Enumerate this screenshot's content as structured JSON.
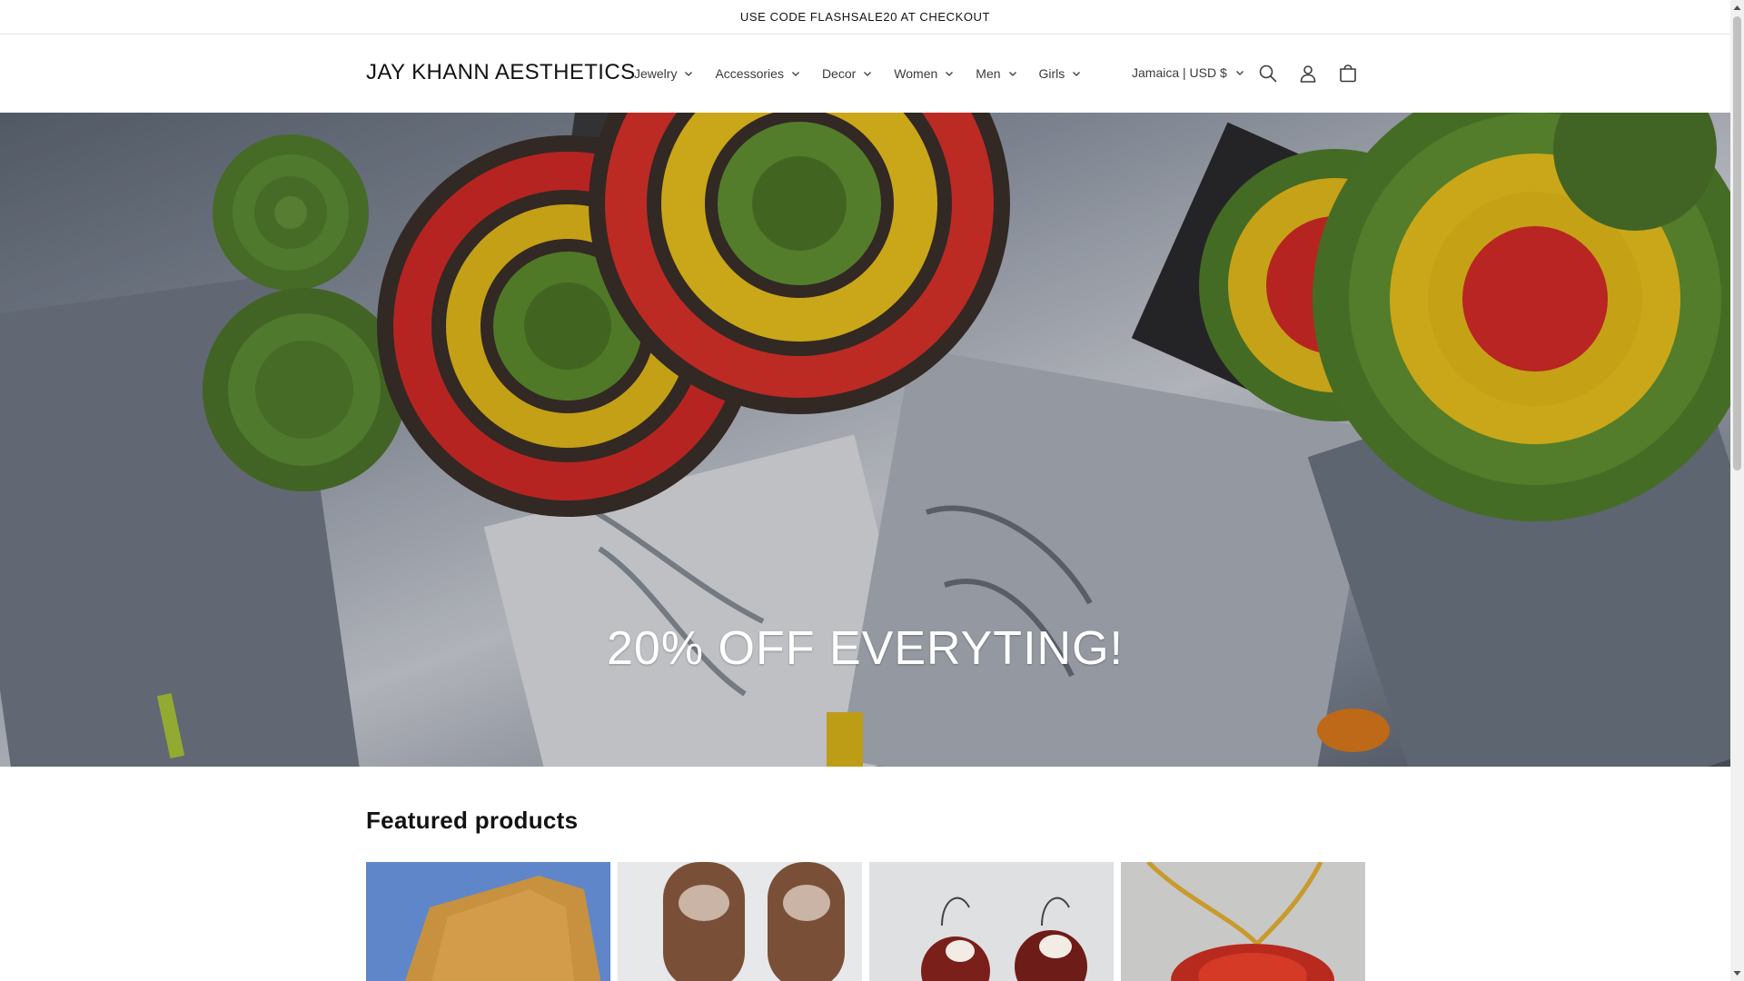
{
  "announcement": {
    "text": "USE CODE FLASHSALE20 AT CHECKOUT"
  },
  "header": {
    "logo": "JAY KHANN AESTHETICS",
    "nav": [
      {
        "label": "Jewelry"
      },
      {
        "label": "Accessories"
      },
      {
        "label": "Decor"
      },
      {
        "label": "Women"
      },
      {
        "label": "Men"
      },
      {
        "label": "Girls"
      }
    ],
    "locale": "Jamaica | USD $",
    "icons": [
      "search-icon",
      "account-icon",
      "cart-icon"
    ]
  },
  "hero": {
    "title": "20% OFF EVERYTING!"
  },
  "featured": {
    "title": "Featured products",
    "products": [
      {
        "image": "product-image-1"
      },
      {
        "image": "product-image-2"
      },
      {
        "image": "product-image-3"
      },
      {
        "image": "product-image-4"
      }
    ]
  },
  "colors": {
    "text": "#121212",
    "background": "#ffffff",
    "border": "#e4e4e4"
  }
}
